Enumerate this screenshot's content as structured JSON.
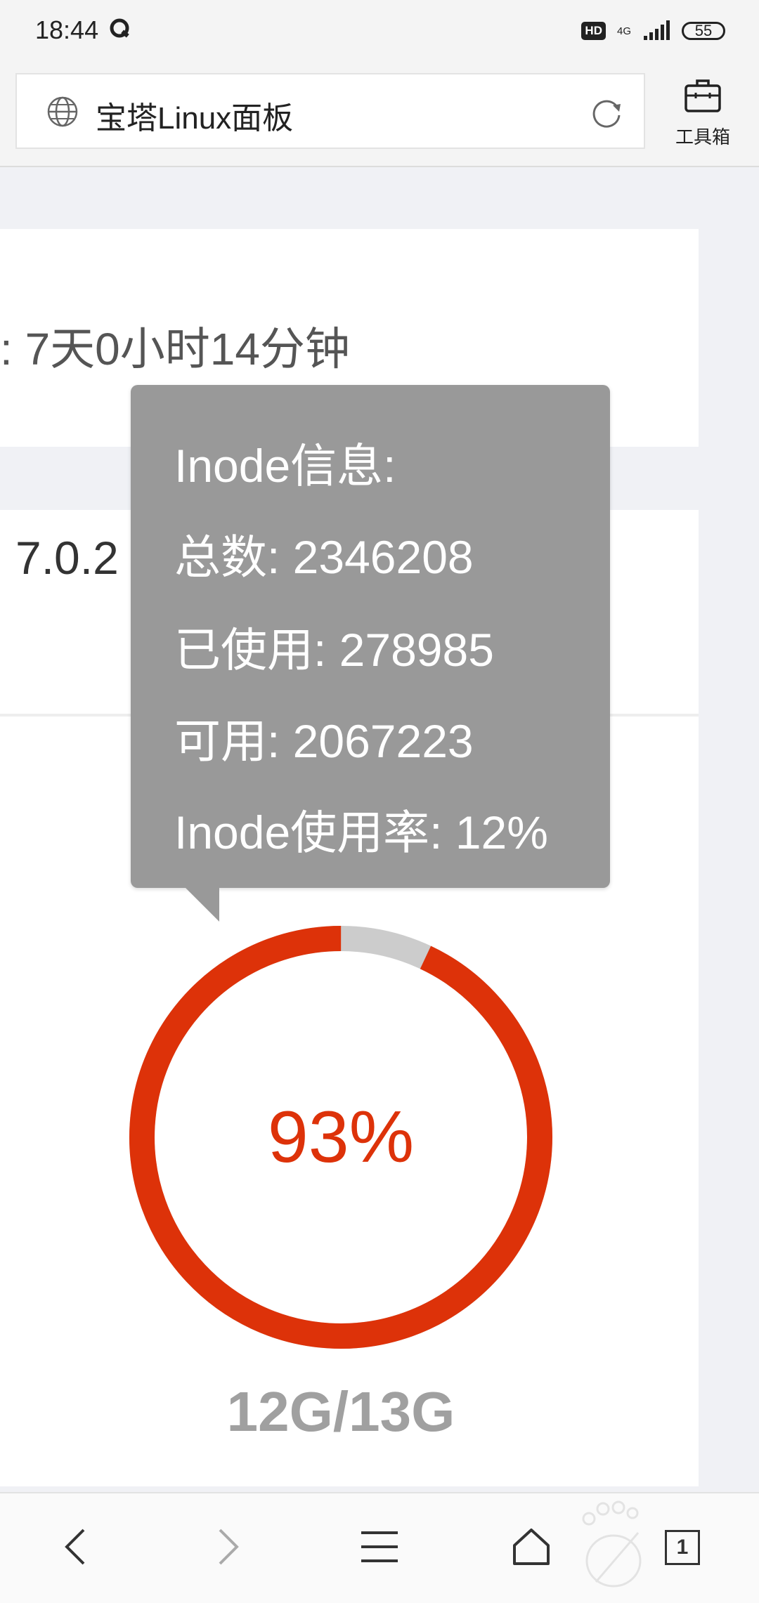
{
  "status_bar": {
    "time": "18:44",
    "badge_hd": "HD",
    "network": "4G",
    "battery": "55"
  },
  "address_bar": {
    "title": "宝塔Linux面板",
    "icons": [
      "globe-icon",
      "reload-icon"
    ]
  },
  "toolbox": {
    "label": "工具箱",
    "icon": "toolbox-icon"
  },
  "server": {
    "uptime": ": 7天0小时14分钟",
    "version": "7.0.2"
  },
  "disk": {
    "percent": "93%",
    "percent_value": 93,
    "size": "12G/13G",
    "colors": {
      "used": "#dd3209",
      "free": "#cccccc"
    }
  },
  "tooltip": {
    "title": "Inode信息:",
    "total": "总数: 2346208",
    "used": "已使用: 278985",
    "free": "可用: 2067223",
    "usage": "Inode使用率: 12%"
  },
  "bottom_nav": {
    "tab_count": "1",
    "icons": [
      "back-icon",
      "forward-icon",
      "menu-icon",
      "home-icon",
      "tabs-icon"
    ]
  }
}
